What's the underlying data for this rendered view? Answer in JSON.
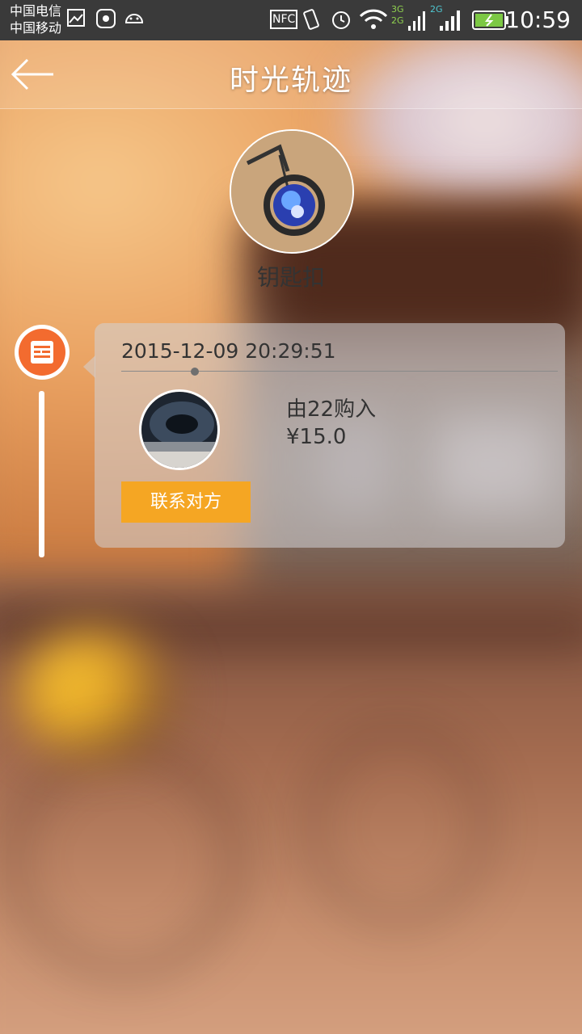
{
  "status_bar": {
    "carrier_1": "中国电信",
    "carrier_2": "中国移动",
    "nfc": "NFC",
    "net_1": "3G",
    "net_2": "2G",
    "net_3": "2G",
    "time": "10:59"
  },
  "header": {
    "title": "时光轨迹",
    "back_icon": "back-arrow-icon"
  },
  "product": {
    "name": "钥匙扣"
  },
  "timeline": [
    {
      "timestamp": "2015-12-09 20:29:51",
      "description": "由22购入",
      "price": "¥15.0",
      "action_label": "联系对方",
      "icon": "document-icon"
    }
  ],
  "colors": {
    "accent_orange": "#f36b2f",
    "button_yellow": "#f5a623",
    "status_bar": "#3a3a3a"
  }
}
